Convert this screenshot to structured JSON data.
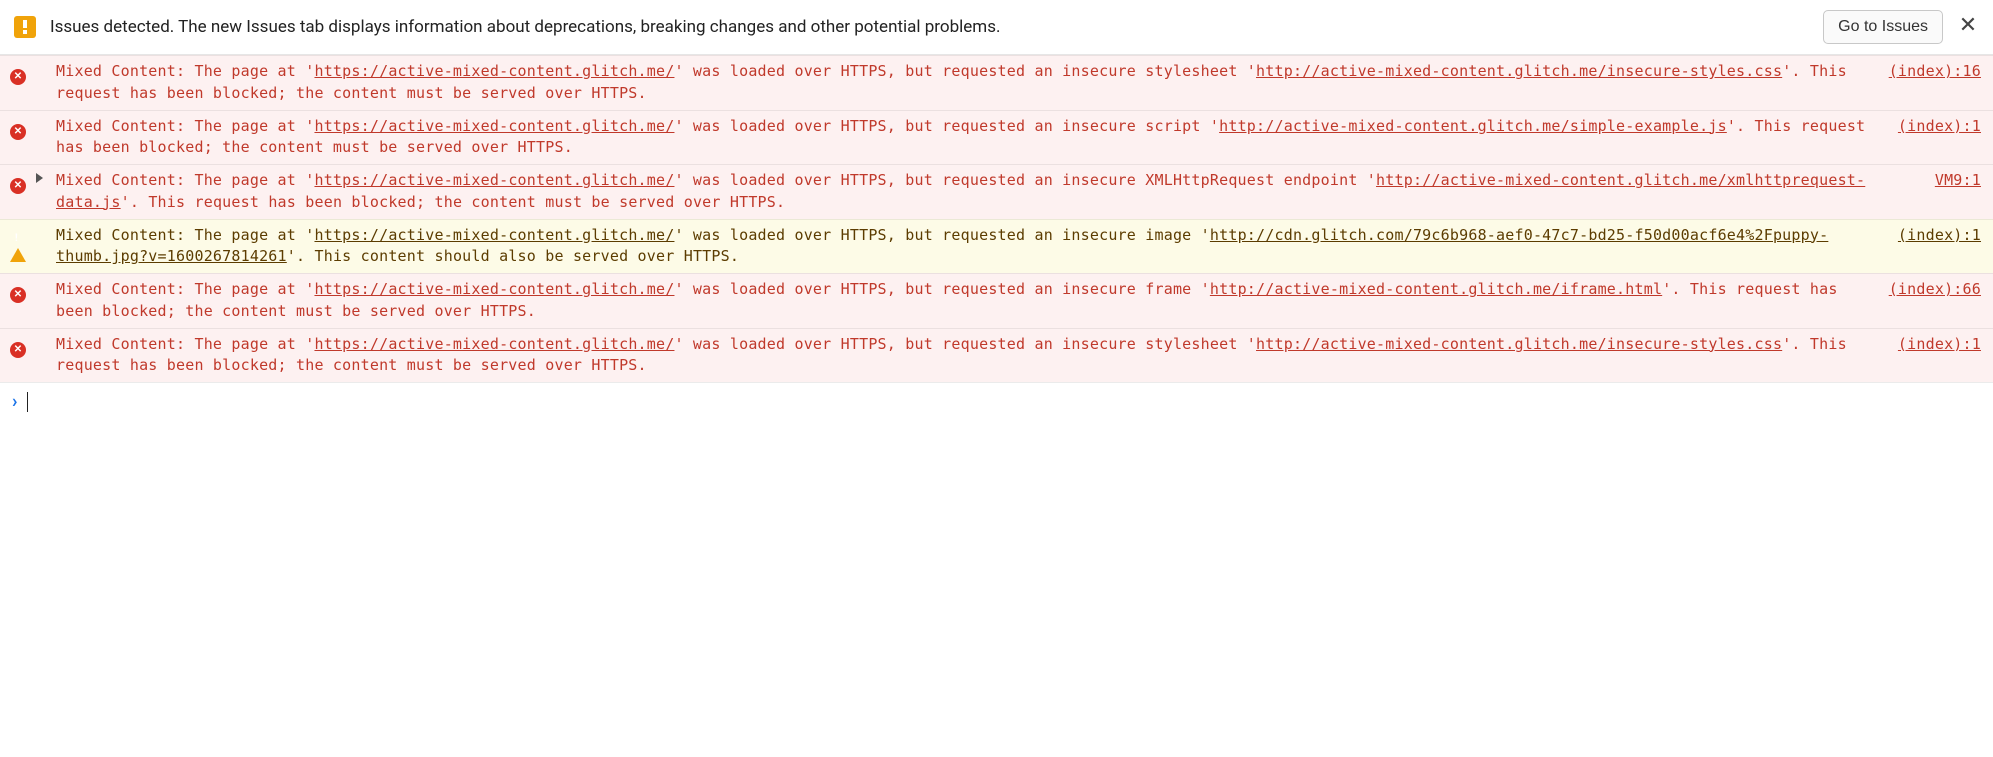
{
  "issues_bar": {
    "text": "Issues detected. The new Issues tab displays information about deprecations, breaking changes and other potential problems.",
    "button_label": "Go to Issues",
    "close_label": "✕"
  },
  "entries": [
    {
      "level": "error",
      "expandable": false,
      "page_url": "https://active-mixed-content.glitch.me/",
      "resource_type": "stylesheet",
      "resource_url": "http://active-mixed-content.glitch.me/insecure-styles.css",
      "tail": "This request has been blocked; the content must be served over HTTPS.",
      "source": "(index):16"
    },
    {
      "level": "error",
      "expandable": false,
      "page_url": "https://active-mixed-content.glitch.me/",
      "resource_type": "script",
      "resource_url": "http://active-mixed-content.glitch.me/simple-example.js",
      "tail": "This request has been blocked; the content must be served over HTTPS.",
      "source": "(index):1"
    },
    {
      "level": "error",
      "expandable": true,
      "page_url": "https://active-mixed-content.glitch.me/",
      "resource_type": "XMLHttpRequest endpoint",
      "resource_url": "http://active-mixed-content.glitch.me/xmlhttprequest-data.js",
      "tail": "This request has been blocked; the content must be served over HTTPS.",
      "source": "VM9:1"
    },
    {
      "level": "warning",
      "expandable": false,
      "page_url": "https://active-mixed-content.glitch.me/",
      "resource_type": "image",
      "resource_url": "http://cdn.glitch.com/79c6b968-aef0-47c7-bd25-f50d00acf6e4%2Fpuppy-thumb.jpg?v=1600267814261",
      "tail": "This content should also be served over HTTPS.",
      "source": "(index):1"
    },
    {
      "level": "error",
      "expandable": false,
      "page_url": "https://active-mixed-content.glitch.me/",
      "resource_type": "frame",
      "resource_url": "http://active-mixed-content.glitch.me/iframe.html",
      "tail": "This request has been blocked; the content must be served over HTTPS.",
      "source": "(index):66"
    },
    {
      "level": "error",
      "expandable": false,
      "page_url": "https://active-mixed-content.glitch.me/",
      "resource_type": "stylesheet",
      "resource_url": "http://active-mixed-content.glitch.me/insecure-styles.css",
      "tail": "This request has been blocked; the content must be served over HTTPS.",
      "source": "(index):1"
    }
  ],
  "prompt": {
    "chevron": "›"
  },
  "strings": {
    "prefix": "Mixed Content: The page at '",
    "mid1": "' was loaded over HTTPS, but requested an insecure ",
    "mid2": " '",
    "mid3": "'. "
  }
}
